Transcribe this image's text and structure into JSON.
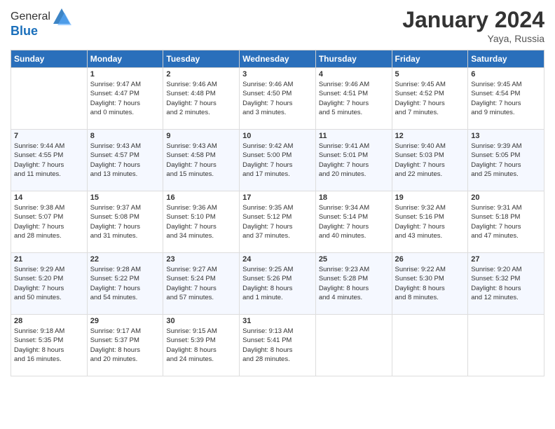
{
  "header": {
    "logo_line1": "General",
    "logo_line2": "Blue",
    "month": "January 2024",
    "location": "Yaya, Russia"
  },
  "weekdays": [
    "Sunday",
    "Monday",
    "Tuesday",
    "Wednesday",
    "Thursday",
    "Friday",
    "Saturday"
  ],
  "weeks": [
    [
      {
        "day": "",
        "info": ""
      },
      {
        "day": "1",
        "info": "Sunrise: 9:47 AM\nSunset: 4:47 PM\nDaylight: 7 hours\nand 0 minutes."
      },
      {
        "day": "2",
        "info": "Sunrise: 9:46 AM\nSunset: 4:48 PM\nDaylight: 7 hours\nand 2 minutes."
      },
      {
        "day": "3",
        "info": "Sunrise: 9:46 AM\nSunset: 4:50 PM\nDaylight: 7 hours\nand 3 minutes."
      },
      {
        "day": "4",
        "info": "Sunrise: 9:46 AM\nSunset: 4:51 PM\nDaylight: 7 hours\nand 5 minutes."
      },
      {
        "day": "5",
        "info": "Sunrise: 9:45 AM\nSunset: 4:52 PM\nDaylight: 7 hours\nand 7 minutes."
      },
      {
        "day": "6",
        "info": "Sunrise: 9:45 AM\nSunset: 4:54 PM\nDaylight: 7 hours\nand 9 minutes."
      }
    ],
    [
      {
        "day": "7",
        "info": "Sunrise: 9:44 AM\nSunset: 4:55 PM\nDaylight: 7 hours\nand 11 minutes."
      },
      {
        "day": "8",
        "info": "Sunrise: 9:43 AM\nSunset: 4:57 PM\nDaylight: 7 hours\nand 13 minutes."
      },
      {
        "day": "9",
        "info": "Sunrise: 9:43 AM\nSunset: 4:58 PM\nDaylight: 7 hours\nand 15 minutes."
      },
      {
        "day": "10",
        "info": "Sunrise: 9:42 AM\nSunset: 5:00 PM\nDaylight: 7 hours\nand 17 minutes."
      },
      {
        "day": "11",
        "info": "Sunrise: 9:41 AM\nSunset: 5:01 PM\nDaylight: 7 hours\nand 20 minutes."
      },
      {
        "day": "12",
        "info": "Sunrise: 9:40 AM\nSunset: 5:03 PM\nDaylight: 7 hours\nand 22 minutes."
      },
      {
        "day": "13",
        "info": "Sunrise: 9:39 AM\nSunset: 5:05 PM\nDaylight: 7 hours\nand 25 minutes."
      }
    ],
    [
      {
        "day": "14",
        "info": "Sunrise: 9:38 AM\nSunset: 5:07 PM\nDaylight: 7 hours\nand 28 minutes."
      },
      {
        "day": "15",
        "info": "Sunrise: 9:37 AM\nSunset: 5:08 PM\nDaylight: 7 hours\nand 31 minutes."
      },
      {
        "day": "16",
        "info": "Sunrise: 9:36 AM\nSunset: 5:10 PM\nDaylight: 7 hours\nand 34 minutes."
      },
      {
        "day": "17",
        "info": "Sunrise: 9:35 AM\nSunset: 5:12 PM\nDaylight: 7 hours\nand 37 minutes."
      },
      {
        "day": "18",
        "info": "Sunrise: 9:34 AM\nSunset: 5:14 PM\nDaylight: 7 hours\nand 40 minutes."
      },
      {
        "day": "19",
        "info": "Sunrise: 9:32 AM\nSunset: 5:16 PM\nDaylight: 7 hours\nand 43 minutes."
      },
      {
        "day": "20",
        "info": "Sunrise: 9:31 AM\nSunset: 5:18 PM\nDaylight: 7 hours\nand 47 minutes."
      }
    ],
    [
      {
        "day": "21",
        "info": "Sunrise: 9:29 AM\nSunset: 5:20 PM\nDaylight: 7 hours\nand 50 minutes."
      },
      {
        "day": "22",
        "info": "Sunrise: 9:28 AM\nSunset: 5:22 PM\nDaylight: 7 hours\nand 54 minutes."
      },
      {
        "day": "23",
        "info": "Sunrise: 9:27 AM\nSunset: 5:24 PM\nDaylight: 7 hours\nand 57 minutes."
      },
      {
        "day": "24",
        "info": "Sunrise: 9:25 AM\nSunset: 5:26 PM\nDaylight: 8 hours\nand 1 minute."
      },
      {
        "day": "25",
        "info": "Sunrise: 9:23 AM\nSunset: 5:28 PM\nDaylight: 8 hours\nand 4 minutes."
      },
      {
        "day": "26",
        "info": "Sunrise: 9:22 AM\nSunset: 5:30 PM\nDaylight: 8 hours\nand 8 minutes."
      },
      {
        "day": "27",
        "info": "Sunrise: 9:20 AM\nSunset: 5:32 PM\nDaylight: 8 hours\nand 12 minutes."
      }
    ],
    [
      {
        "day": "28",
        "info": "Sunrise: 9:18 AM\nSunset: 5:35 PM\nDaylight: 8 hours\nand 16 minutes."
      },
      {
        "day": "29",
        "info": "Sunrise: 9:17 AM\nSunset: 5:37 PM\nDaylight: 8 hours\nand 20 minutes."
      },
      {
        "day": "30",
        "info": "Sunrise: 9:15 AM\nSunset: 5:39 PM\nDaylight: 8 hours\nand 24 minutes."
      },
      {
        "day": "31",
        "info": "Sunrise: 9:13 AM\nSunset: 5:41 PM\nDaylight: 8 hours\nand 28 minutes."
      },
      {
        "day": "",
        "info": ""
      },
      {
        "day": "",
        "info": ""
      },
      {
        "day": "",
        "info": ""
      }
    ]
  ]
}
